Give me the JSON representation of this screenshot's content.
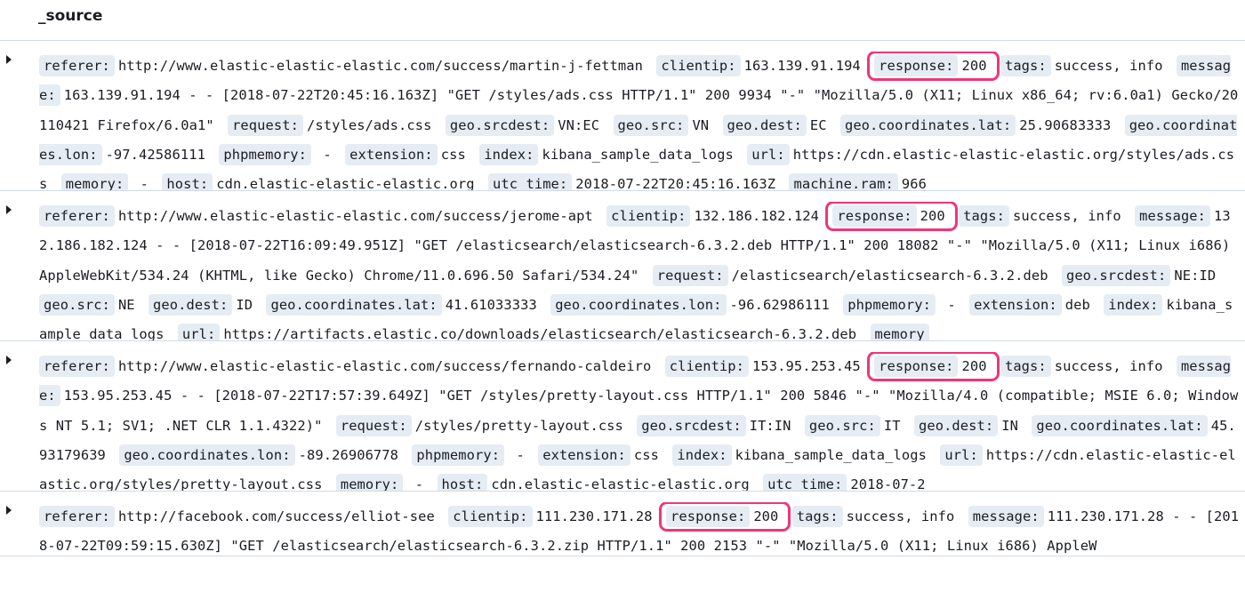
{
  "header": {
    "title": "_source"
  },
  "highlight_color": "#f0357a",
  "rows": [
    {
      "fields": [
        {
          "k": "referer:",
          "v": "http://www.elastic-elastic-elastic.com/success/martin-j-fettman"
        },
        {
          "k": "clientip:",
          "v": "163.139.91.194"
        },
        {
          "k": "response:",
          "v": "200",
          "highlight": true
        },
        {
          "k": "tags:",
          "v": "success, info"
        },
        {
          "k": "message:",
          "v": "163.139.91.194 - - [2018-07-22T20:45:16.163Z] \"GET /styles/ads.css HTTP/1.1\" 200 9934 \"-\" \"Mozilla/5.0 (X11; Linux x86_64; rv:6.0a1) Gecko/20110421 Firefox/6.0a1\""
        },
        {
          "k": "request:",
          "v": "/styles/ads.css"
        },
        {
          "k": "geo.srcdest:",
          "v": "VN:EC"
        },
        {
          "k": "geo.src:",
          "v": "VN"
        },
        {
          "k": "geo.dest:",
          "v": "EC"
        },
        {
          "k": "geo.coordinates.lat:",
          "v": "25.90683333"
        },
        {
          "k": "geo.coordinates.lon:",
          "v": "-97.42586111"
        },
        {
          "k": "phpmemory:",
          "v": " - "
        },
        {
          "k": "extension:",
          "v": "css"
        },
        {
          "k": "index:",
          "v": "kibana_sample_data_logs"
        },
        {
          "k": "url:",
          "v": "https://cdn.elastic-elastic-elastic.org/styles/ads.css"
        },
        {
          "k": "memory:",
          "v": " - "
        },
        {
          "k": "host:",
          "v": "cdn.elastic-elastic-elastic.org"
        },
        {
          "k": "utc_time:",
          "v": "2018-07-22T20:45:16.163Z"
        },
        {
          "k": "machine.ram:",
          "v": "966"
        }
      ]
    },
    {
      "fields": [
        {
          "k": "referer:",
          "v": "http://www.elastic-elastic-elastic.com/success/jerome-apt"
        },
        {
          "k": "clientip:",
          "v": "132.186.182.124"
        },
        {
          "k": "response:",
          "v": "200",
          "highlight": true
        },
        {
          "k": "tags:",
          "v": "success, info"
        },
        {
          "k": "message:",
          "v": "132.186.182.124 - - [2018-07-22T16:09:49.951Z] \"GET /elasticsearch/elasticsearch-6.3.2.deb HTTP/1.1\" 200 18082 \"-\" \"Mozilla/5.0 (X11; Linux i686) AppleWebKit/534.24 (KHTML, like Gecko) Chrome/11.0.696.50 Safari/534.24\""
        },
        {
          "k": "request:",
          "v": "/elasticsearch/elasticsearch-6.3.2.deb"
        },
        {
          "k": "geo.srcdest:",
          "v": "NE:ID"
        },
        {
          "k": "geo.src:",
          "v": "NE"
        },
        {
          "k": "geo.dest:",
          "v": "ID"
        },
        {
          "k": "geo.coordinates.lat:",
          "v": "41.61033333"
        },
        {
          "k": "geo.coordinates.lon:",
          "v": "-96.62986111"
        },
        {
          "k": "phpmemory:",
          "v": " - "
        },
        {
          "k": "extension:",
          "v": "deb"
        },
        {
          "k": "index:",
          "v": "kibana_sample_data_logs"
        },
        {
          "k": "url:",
          "v": "https://artifacts.elastic.co/downloads/elasticsearch/elasticsearch-6.3.2.deb"
        },
        {
          "k": "memory",
          "v": ""
        }
      ]
    },
    {
      "fields": [
        {
          "k": "referer:",
          "v": "http://www.elastic-elastic-elastic.com/success/fernando-caldeiro"
        },
        {
          "k": "clientip:",
          "v": "153.95.253.45"
        },
        {
          "k": "response:",
          "v": "200",
          "highlight": true
        },
        {
          "k": "tags:",
          "v": "success, info"
        },
        {
          "k": "message:",
          "v": "153.95.253.45 - - [2018-07-22T17:57:39.649Z] \"GET /styles/pretty-layout.css HTTP/1.1\" 200 5846 \"-\" \"Mozilla/4.0 (compatible; MSIE 6.0; Windows NT 5.1; SV1; .NET CLR 1.1.4322)\""
        },
        {
          "k": "request:",
          "v": "/styles/pretty-layout.css"
        },
        {
          "k": "geo.srcdest:",
          "v": "IT:IN"
        },
        {
          "k": "geo.src:",
          "v": "IT"
        },
        {
          "k": "geo.dest:",
          "v": "IN"
        },
        {
          "k": "geo.coordinates.lat:",
          "v": "45.93179639"
        },
        {
          "k": "geo.coordinates.lon:",
          "v": "-89.26906778"
        },
        {
          "k": "phpmemory:",
          "v": " - "
        },
        {
          "k": "extension:",
          "v": "css"
        },
        {
          "k": "index:",
          "v": "kibana_sample_data_logs"
        },
        {
          "k": "url:",
          "v": "https://cdn.elastic-elastic-elastic.org/styles/pretty-layout.css"
        },
        {
          "k": "memory:",
          "v": " - "
        },
        {
          "k": "host:",
          "v": "cdn.elastic-elastic-elastic.org"
        },
        {
          "k": "utc_time:",
          "v": "2018-07-2"
        }
      ]
    },
    {
      "fields": [
        {
          "k": "referer:",
          "v": "http://facebook.com/success/elliot-see"
        },
        {
          "k": "clientip:",
          "v": "111.230.171.28"
        },
        {
          "k": "response:",
          "v": "200",
          "highlight": true
        },
        {
          "k": "tags:",
          "v": "success, info"
        },
        {
          "k": "message:",
          "v": "111.230.171.28 - - [2018-07-22T09:59:15.630Z] \"GET /elasticsearch/elasticsearch-6.3.2.zip HTTP/1.1\" 200 2153 \"-\" \"Mozilla/5.0 (X11; Linux i686) AppleW"
        }
      ]
    }
  ]
}
